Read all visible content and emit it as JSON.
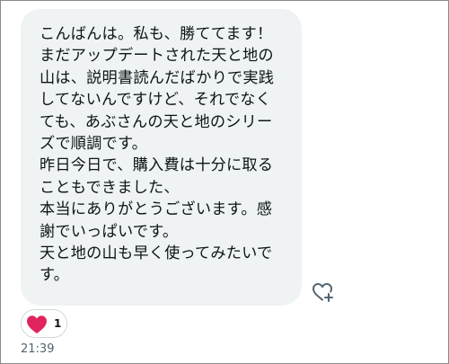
{
  "message": {
    "lines": [
      "こんばんは。私も、勝ててます！",
      "まだアップデートされた天と地の",
      "山は、説明書読んだばかりで実践",
      "してないんですけど、それでなく",
      "ても、あぶさんの天と地のシリー",
      "ズで順調です。",
      "昨日今日で、購入費は十分に取る",
      "こともできました、",
      "本当にありがとうございます。感",
      "謝でいっぱいです。",
      "天と地の山も早く使ってみたいで",
      "す。"
    ],
    "bubble_color": "#eff3f4"
  },
  "reaction": {
    "icon": "heart-icon",
    "count": "1",
    "color": "#e0245e"
  },
  "add_reaction_icon": "heart-plus-icon",
  "timestamp": "21:39"
}
